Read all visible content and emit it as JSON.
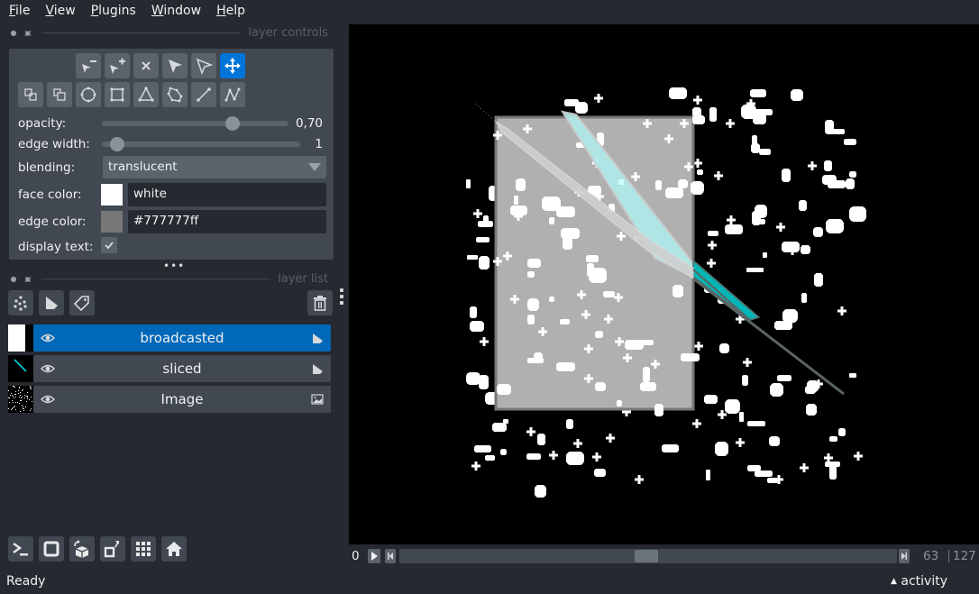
{
  "menu": [
    {
      "label": "File",
      "mnemonic": "F",
      "rest": "ile"
    },
    {
      "label": "View",
      "mnemonic": "V",
      "rest": "iew"
    },
    {
      "label": "Plugins",
      "mnemonic": "P",
      "rest": "lugins"
    },
    {
      "label": "Window",
      "mnemonic": "W",
      "rest": "indow"
    },
    {
      "label": "Help",
      "mnemonic": "H",
      "rest": "elp"
    }
  ],
  "layer_controls": {
    "title": "layer controls",
    "mode_buttons_row1": [
      "remove-vertex",
      "add-vertex",
      "delete-shape",
      "select-shape",
      "direct-select",
      "pan-zoom"
    ],
    "mode_buttons_row2": [
      "move-back",
      "move-front",
      "add-ellipse",
      "add-rectangle",
      "add-triangle",
      "add-polygon",
      "add-line",
      "add-path"
    ],
    "active_mode": "pan-zoom",
    "opacity": {
      "label": "opacity:",
      "value": 0.7,
      "display": "0,70"
    },
    "edge_width": {
      "label": "edge width:",
      "value": 1,
      "display": "1",
      "min": 0,
      "max": 40
    },
    "blending": {
      "label": "blending:",
      "value": "translucent"
    },
    "face_color": {
      "label": "face color:",
      "value": "white",
      "swatch": "#ffffff"
    },
    "edge_color": {
      "label": "edge color:",
      "value": "#777777ff",
      "swatch": "#777777"
    },
    "display_text": {
      "label": "display text:",
      "checked": true
    }
  },
  "layer_list": {
    "title": "layer list",
    "layers": [
      {
        "name": "broadcasted",
        "type": "shapes",
        "selected": true,
        "visible": true
      },
      {
        "name": "sliced",
        "type": "shapes",
        "selected": false,
        "visible": true
      },
      {
        "name": "Image",
        "type": "image",
        "selected": false,
        "visible": true
      }
    ]
  },
  "dims": {
    "min_label": "0",
    "current": "63",
    "max": "127",
    "position_fraction": 0.496
  },
  "status": "Ready",
  "activity": "activity",
  "colors": {
    "accent": "#0075d9",
    "selected_layer": "#0068b8",
    "panel": "#414851",
    "background": "#262930",
    "cyan_shape": "#00b5b5",
    "light_cyan": "#b0e8e8",
    "rect_fill": "#b0b0b0"
  }
}
